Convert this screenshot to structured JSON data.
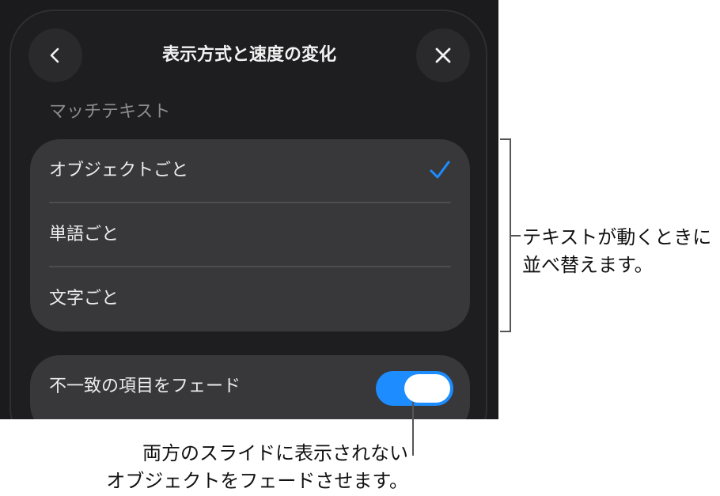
{
  "dialog": {
    "title": "表示方式と速度の変化",
    "back_icon": "chevron-left-icon",
    "close_icon": "close-icon"
  },
  "match_text": {
    "section_label": "マッチテキスト",
    "options": [
      {
        "label": "オブジェクトごと",
        "selected": true
      },
      {
        "label": "単語ごと",
        "selected": false
      },
      {
        "label": "文字ごと",
        "selected": false
      }
    ],
    "check_icon": "checkmark-icon"
  },
  "fade": {
    "label": "不一致の項目をフェード",
    "enabled": true
  },
  "callouts": {
    "options_note_line1": "テキストが動くときに",
    "options_note_line2": "並べ替えます。",
    "fade_note_line1": "両方のスライドに表示されない",
    "fade_note_line2": "オブジェクトをフェードさせます。"
  },
  "colors": {
    "accent": "#1c8cff",
    "background": "#1b1b1d",
    "group_background": "#38383a"
  }
}
